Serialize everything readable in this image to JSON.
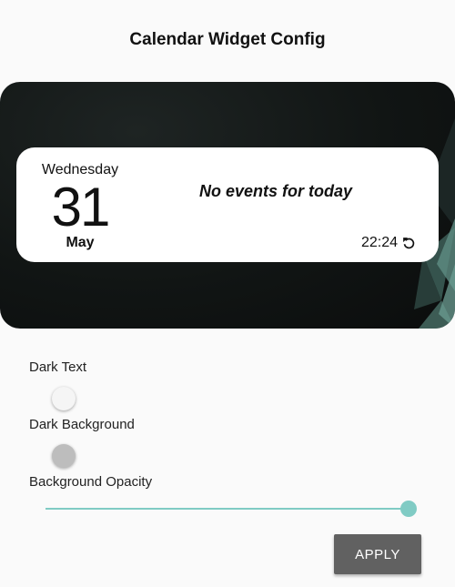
{
  "page": {
    "title": "Calendar Widget Config"
  },
  "widget": {
    "day_name": "Wednesday",
    "date": "31",
    "month": "May",
    "events_text": "No events for today",
    "time": "22:24",
    "refresh_icon": "refresh-icon"
  },
  "settings": {
    "dark_text": {
      "label": "Dark Text",
      "checked": false,
      "thumb_color": "#f5f5f5"
    },
    "dark_background": {
      "label": "Dark Background",
      "checked": false,
      "thumb_color": "#bdbdbd"
    },
    "background_opacity": {
      "label": "Background Opacity",
      "value": 1.0,
      "accent": "#80cbc4"
    }
  },
  "actions": {
    "apply_label": "APPLY"
  }
}
